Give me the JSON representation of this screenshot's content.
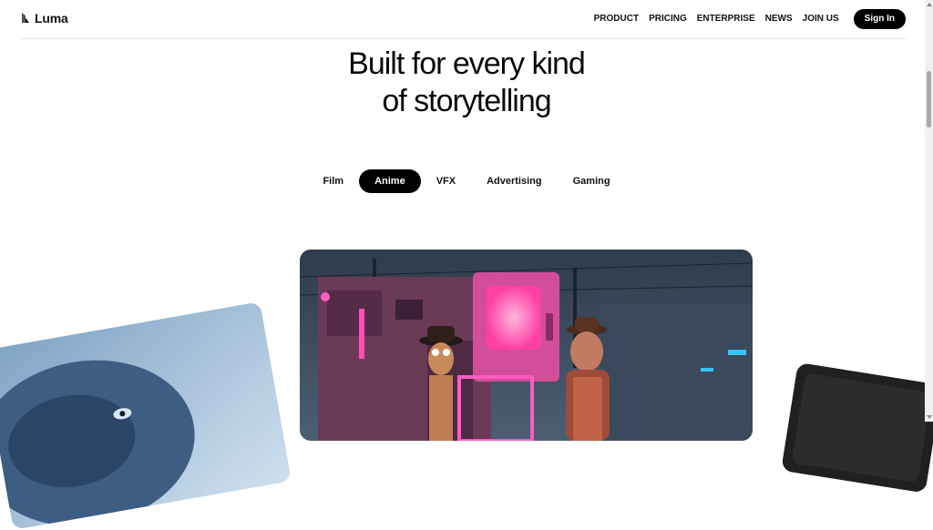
{
  "header": {
    "logo_text": "Luma",
    "nav": [
      "PRODUCT",
      "PRICING",
      "ENTERPRISE",
      "NEWS",
      "JOIN US"
    ],
    "signin_label": "Sign In"
  },
  "hero": {
    "line1": "Built for every kind",
    "line2": "of storytelling"
  },
  "tabs": [
    {
      "label": "Film",
      "active": false
    },
    {
      "label": "Anime",
      "active": true
    },
    {
      "label": "VFX",
      "active": false
    },
    {
      "label": "Advertising",
      "active": false
    },
    {
      "label": "Gaming",
      "active": false
    }
  ],
  "colors": {
    "accent": "#000000",
    "neon_pink": "#ff3fa4",
    "night_sky": "#3b4a5c"
  },
  "icons": {
    "logo": "luma-logo-icon"
  },
  "carousel": {
    "items": [
      "blue-creature-image",
      "neon-anime-characters-image",
      "dark-device-image"
    ]
  }
}
